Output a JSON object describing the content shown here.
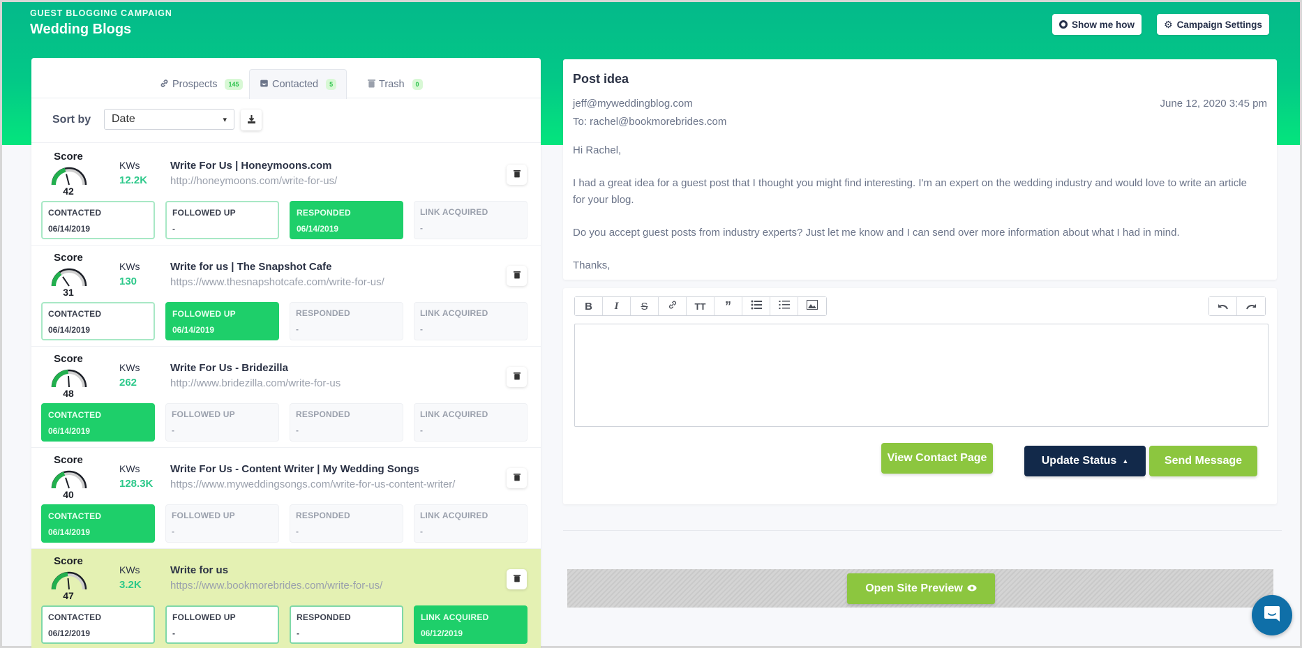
{
  "header": {
    "subtitle": "GUEST BLOGGING CAMPAIGN",
    "title": "Wedding Blogs",
    "show_me_how": "Show me how",
    "campaign_settings": "Campaign Settings"
  },
  "tabs": [
    {
      "label": "Prospects",
      "count": "145",
      "icon": "link-icon",
      "active": false
    },
    {
      "label": "Contacted",
      "count": "5",
      "icon": "inbox-icon",
      "active": true
    },
    {
      "label": "Trash",
      "count": "0",
      "icon": "trash-icon",
      "active": false
    }
  ],
  "sort": {
    "label": "Sort by",
    "value": "Date"
  },
  "labels": {
    "score": "Score",
    "kws": "KWs",
    "contacted": "CONTACTED",
    "followed_up": "FOLLOWED UP",
    "responded": "RESPONDED",
    "link_acquired": "LINK ACQUIRED"
  },
  "prospects": [
    {
      "score": 42,
      "kws": "12.2K",
      "title": "Write For Us | Honeymoons.com",
      "url": "http://honeymoons.com/write-for-us/",
      "selected": false,
      "statuses": [
        {
          "state": "done",
          "date": "06/14/2019"
        },
        {
          "state": "done",
          "date": "-"
        },
        {
          "state": "active",
          "date": "06/14/2019"
        },
        {
          "state": "pending",
          "date": "-"
        }
      ]
    },
    {
      "score": 31,
      "kws": "130",
      "title": "Write for us | The Snapshot Cafe",
      "url": "https://www.thesnapshotcafe.com/write-for-us/",
      "selected": false,
      "statuses": [
        {
          "state": "done",
          "date": "06/14/2019"
        },
        {
          "state": "active",
          "date": "06/14/2019"
        },
        {
          "state": "pending",
          "date": "-"
        },
        {
          "state": "pending",
          "date": "-"
        }
      ]
    },
    {
      "score": 48,
      "kws": "262",
      "title": "Write For Us - Bridezilla",
      "url": "http://www.bridezilla.com/write-for-us",
      "selected": false,
      "statuses": [
        {
          "state": "active",
          "date": "06/14/2019"
        },
        {
          "state": "pending",
          "date": "-"
        },
        {
          "state": "pending",
          "date": "-"
        },
        {
          "state": "pending",
          "date": "-"
        }
      ]
    },
    {
      "score": 40,
      "kws": "128.3K",
      "title": "Write For Us - Content Writer | My Wedding Songs",
      "url": "https://www.myweddingsongs.com/write-for-us-content-writer/",
      "selected": false,
      "statuses": [
        {
          "state": "active",
          "date": "06/14/2019"
        },
        {
          "state": "pending",
          "date": "-"
        },
        {
          "state": "pending",
          "date": "-"
        },
        {
          "state": "pending",
          "date": "-"
        }
      ]
    },
    {
      "score": 47,
      "kws": "3.2K",
      "title": "Write for us",
      "url": "https://www.bookmorebrides.com/write-for-us/",
      "selected": true,
      "statuses": [
        {
          "state": "done",
          "date": "06/12/2019"
        },
        {
          "state": "done",
          "date": "-"
        },
        {
          "state": "done",
          "date": "-"
        },
        {
          "state": "active",
          "date": "06/12/2019"
        }
      ]
    }
  ],
  "email": {
    "subject": "Post idea",
    "from": "jeff@myweddingblog.com",
    "to": "To: rachel@bookmorebrides.com",
    "date": "June 12, 2020 3:45 pm",
    "body": [
      "Hi Rachel,",
      "I had a great idea for a guest post that I thought you might find interesting. I'm an expert on the wedding industry and would love to write an article for your blog.",
      "Do you accept guest posts from industry experts? Just let me know and I can send over more information about what I had in mind.",
      "Thanks,"
    ]
  },
  "composer": {
    "toolbar": [
      "bold",
      "italic",
      "strikethrough",
      "link",
      "heading",
      "quote",
      "bullet-list",
      "numbered-list",
      "image"
    ],
    "history": [
      "undo",
      "redo"
    ],
    "editor_value": ""
  },
  "actions": {
    "view_contact_page": "View Contact Page",
    "update_status": "Update Status",
    "send_message": "Send Message",
    "open_site_preview": "Open Site Preview"
  },
  "colors": {
    "brand_green": "#03c987",
    "status_active": "#1ecf6a",
    "action_green": "#8cc63f",
    "navy": "#12294a",
    "selected_row": "#e4f1b3",
    "chat_blue": "#0f6fa8"
  }
}
